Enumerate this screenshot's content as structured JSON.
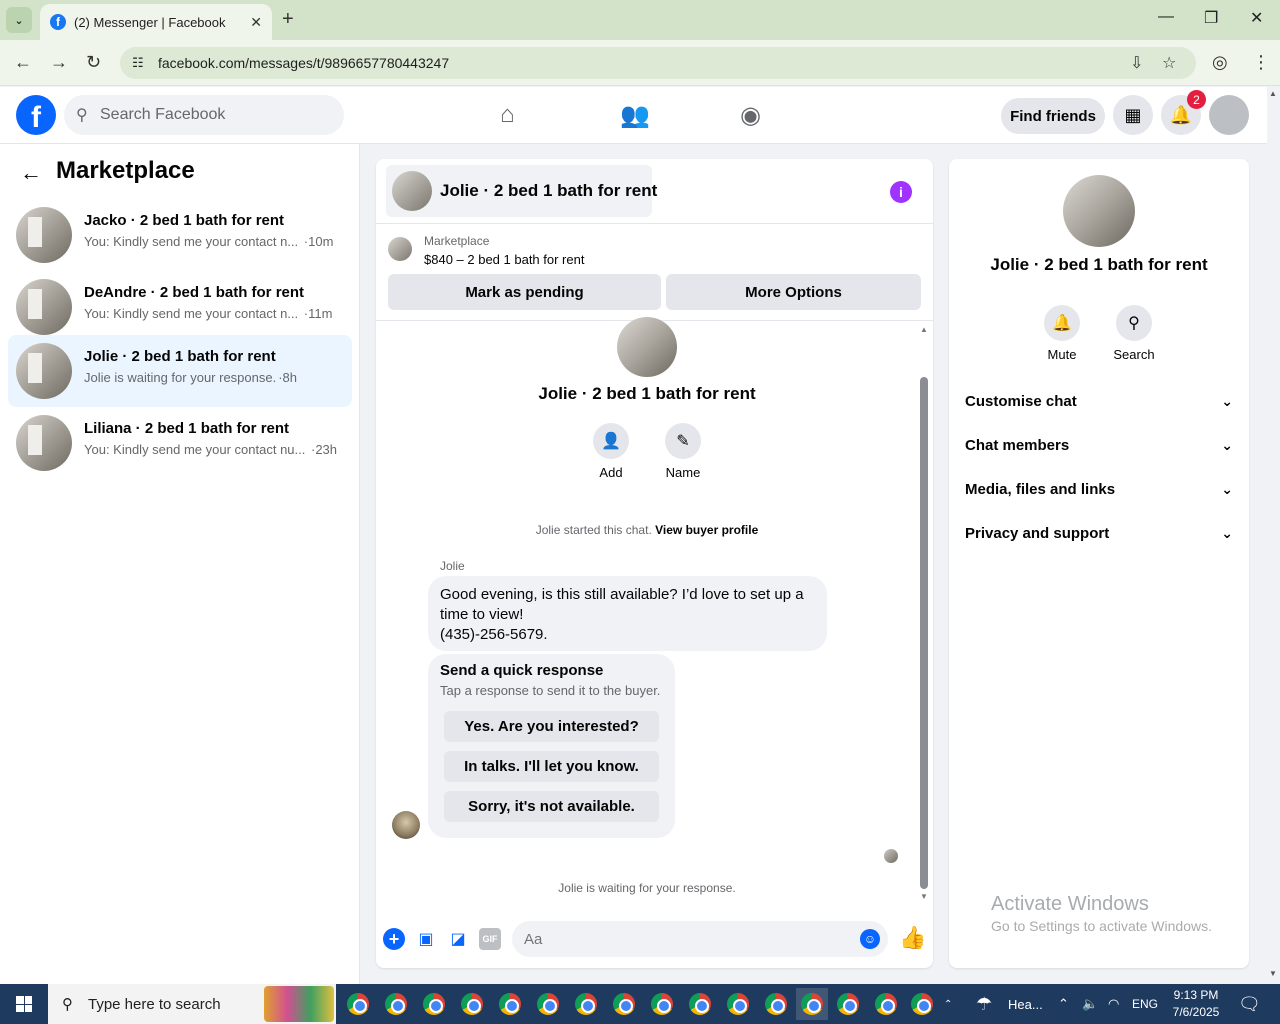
{
  "browser": {
    "tab_title": "(2) Messenger | Facebook",
    "url": "facebook.com/messages/t/9896657780443247"
  },
  "fb": {
    "search_placeholder": "Search Facebook",
    "find_friends": "Find friends",
    "notif_count": "2"
  },
  "sidebar": {
    "title": "Marketplace",
    "conversations": [
      {
        "name": "Jacko · 2 bed 1 bath for rent",
        "preview": "You: Kindly send me your contact n...",
        "time": "·10m"
      },
      {
        "name": "DeAndre · 2 bed 1 bath for rent",
        "preview": "You: Kindly send me your contact n...",
        "time": "·11m"
      },
      {
        "name": "Jolie · 2 bed 1 bath for rent",
        "preview": "Jolie is waiting for your response.",
        "time": "·8h"
      },
      {
        "name": "Liliana · 2 bed 1 bath for rent",
        "preview": "You: Kindly send me your contact nu...",
        "time": "·23h"
      }
    ]
  },
  "chat": {
    "title": "Jolie · 2 bed 1 bath for rent",
    "marketplace_label": "Marketplace",
    "listing": "$840 – 2 bed 1 bath for rent",
    "mark_pending": "Mark as pending",
    "more_options": "More Options",
    "actions": {
      "add": "Add",
      "name": "Name"
    },
    "started_text": "Jolie started this chat.",
    "view_profile": "View buyer profile",
    "sender": "Jolie",
    "message_lines": [
      "Good evening, is this still available? I’d love to set up a",
      "time to view!",
      "(435)-256-5679."
    ],
    "quick_title": "Send a quick response",
    "quick_sub": "Tap a response to send it to the buyer.",
    "quick_replies": [
      "Yes. Are you interested?",
      "In talks. I'll let you know.",
      "Sorry, it's not available."
    ],
    "waiting": "Jolie is waiting for your response.",
    "input_placeholder": "Aa"
  },
  "rpanel": {
    "title": "Jolie · 2 bed 1 bath for rent",
    "mute": "Mute",
    "search": "Search",
    "rows": [
      "Customise chat",
      "Chat members",
      "Media, files and links",
      "Privacy and support"
    ],
    "activate_title": "Activate Windows",
    "activate_sub": "Go to Settings to activate Windows."
  },
  "taskbar": {
    "search_placeholder": "Type here to search",
    "weather": "Hea...",
    "lang": "ENG",
    "time": "9:13 PM",
    "date": "7/6/2025"
  }
}
